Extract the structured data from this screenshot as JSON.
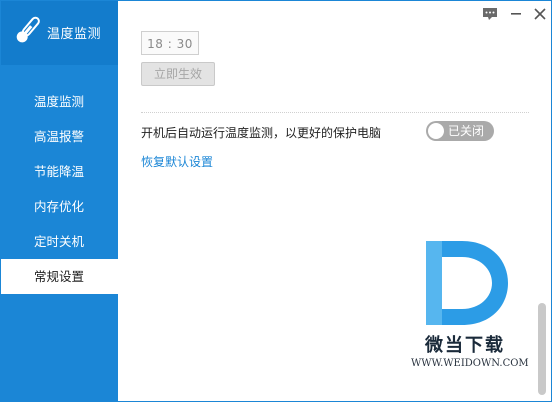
{
  "app": {
    "title": "温度监测",
    "logo_icon": "thermometer-icon"
  },
  "window_controls": {
    "feedback_icon": "chat-icon",
    "minimize_icon": "minimize-icon",
    "close_icon": "close-icon"
  },
  "sidebar": {
    "items": [
      {
        "label": "温度监测"
      },
      {
        "label": "高温报警"
      },
      {
        "label": "节能降温"
      },
      {
        "label": "内存优化"
      },
      {
        "label": "定时关机"
      },
      {
        "label": "常规设置",
        "active": true
      }
    ]
  },
  "content": {
    "time_value": "18 : 30",
    "apply_button": "立即生效",
    "startup_label": "开机后自动运行温度监测，以更好的保护电脑",
    "startup_toggle": {
      "state_label": "已关闭",
      "on": false
    },
    "restore_link": "恢复默认设置"
  },
  "watermark": {
    "title": "微当下载",
    "url": "WWW.WEIDOWN.COM"
  },
  "colors": {
    "brand_blue": "#1b86d6",
    "header_blue": "#137ccc",
    "toggle_off": "#aaaaaa",
    "link": "#1b86d6"
  }
}
